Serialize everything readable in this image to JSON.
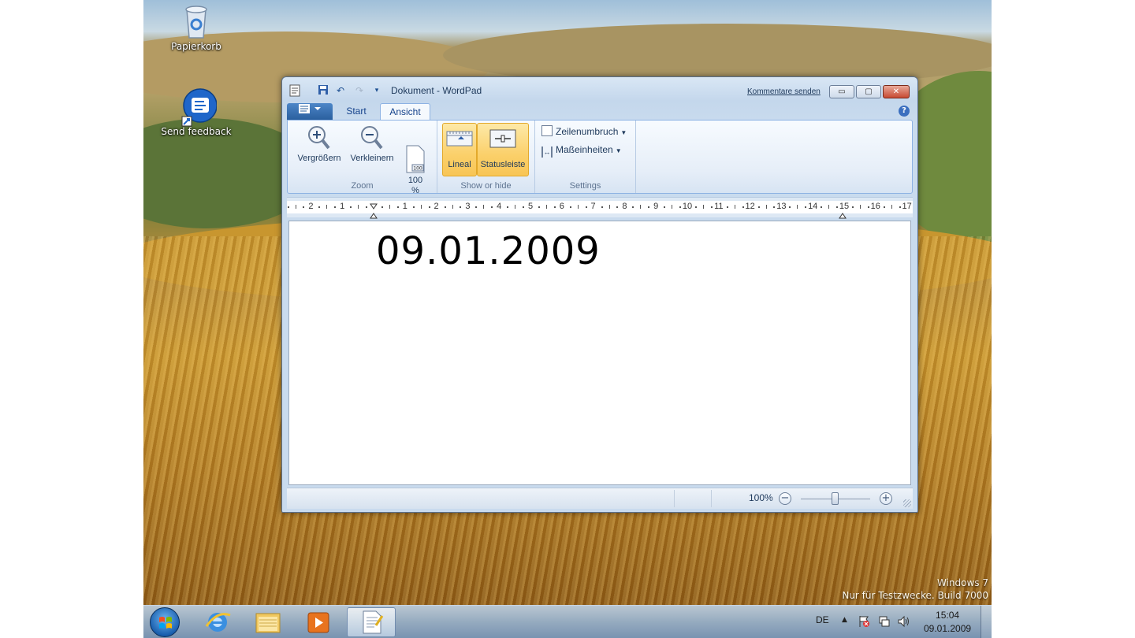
{
  "desktop": {
    "icons": [
      {
        "label": "Papierkorb",
        "icon": "recycle-bin-icon"
      },
      {
        "label": "Send feedback",
        "icon": "feedback-icon"
      }
    ],
    "watermark_line1": "Windows 7",
    "watermark_line2": "Nur für Testzwecke. Build 7000"
  },
  "window": {
    "title": "Dokument - WordPad",
    "feedback_link": "Kommentare senden",
    "caption_buttons": {
      "minimize": "▭",
      "maximize": "▢",
      "close": "✕"
    },
    "quick_access": [
      "save-icon",
      "undo-icon",
      "redo-icon",
      "customize-icon"
    ],
    "tabs": [
      {
        "label": "Start",
        "active": false
      },
      {
        "label": "Ansicht",
        "active": true
      }
    ],
    "help": "?"
  },
  "ribbon": {
    "groups": [
      {
        "label": "Zoom",
        "buttons": [
          {
            "label": "Vergrößern",
            "icon": "zoom-in-icon"
          },
          {
            "label": "Verkleinern",
            "icon": "zoom-out-icon"
          },
          {
            "label": "100\n%",
            "icon": "page-100-icon"
          }
        ]
      },
      {
        "label": "Show or hide",
        "buttons": [
          {
            "label": "Lineal",
            "icon": "ruler-icon",
            "checked": true
          },
          {
            "label": "Statusleiste",
            "icon": "statusbar-icon",
            "checked": true
          }
        ]
      },
      {
        "label": "Settings",
        "buttons": [
          {
            "label": "Zeilenumbruch",
            "icon": "word-wrap-icon"
          },
          {
            "label": "Maßeinheiten",
            "icon": "units-icon"
          }
        ]
      }
    ]
  },
  "ruler": {
    "labels": [
      "2",
      "1",
      "1",
      "2",
      "3",
      "4",
      "5",
      "6",
      "7",
      "8",
      "9",
      "10",
      "11",
      "12",
      "13",
      "14",
      "15",
      "16",
      "17"
    ]
  },
  "document": {
    "text": "09.01.2009"
  },
  "statusbar": {
    "zoom": "100%",
    "zoom_level": 1.0
  },
  "taskbar": {
    "apps": [
      {
        "name": "internet-explorer-icon",
        "active": false
      },
      {
        "name": "explorer-folder-icon",
        "active": false
      },
      {
        "name": "media-player-icon",
        "active": false
      },
      {
        "name": "wordpad-icon",
        "active": true
      }
    ],
    "language": "DE",
    "time": "15:04",
    "date": "09.01.2009"
  }
}
